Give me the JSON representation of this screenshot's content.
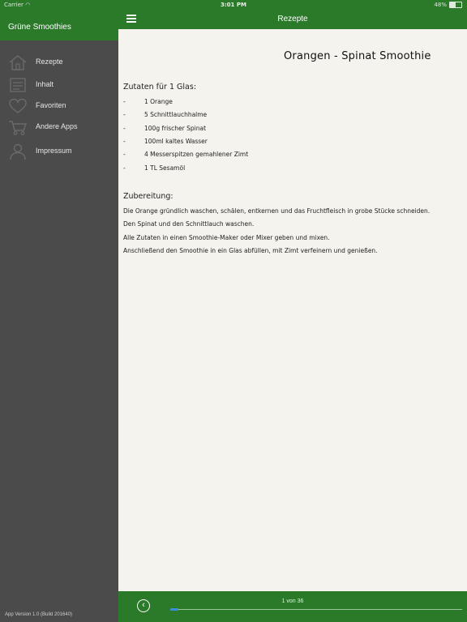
{
  "status": {
    "carrier": "Carrier",
    "time": "3:01 PM",
    "battery": "48%",
    "battery_level": 0.48
  },
  "sidebar": {
    "title": "Grüne Smoothies",
    "items": [
      {
        "label": "Rezepte",
        "icon": "house-icon"
      },
      {
        "label": "Inhalt",
        "icon": "contents-icon"
      },
      {
        "label": "Favoriten",
        "icon": "heart-icon"
      },
      {
        "label": "Andere Apps",
        "icon": "shopping-cart-icon"
      },
      {
        "label": "Impressum",
        "icon": "person-icon"
      }
    ],
    "app_version": "App Version 1.0 (Build 201640)"
  },
  "navbar": {
    "title": "Rezepte"
  },
  "recipe": {
    "title": "Orangen - Spinat Smoothie",
    "ingredients_heading": "Zutaten für 1 Glas:",
    "ingredients": [
      "1 Orange",
      "5 Schnittlauchhalme",
      "100g frischer Spinat",
      "100ml kaltes Wasser",
      "4 Messerspitzen gemahlener Zimt",
      "1 TL Sesamöl"
    ],
    "preparation_heading": "Zubereitung:",
    "preparation": [
      "Die Orange gründlich waschen, schälen, entkernen und das Fruchtfleisch in grobe Stücke schneiden.",
      "Den Spinat und den Schnittlauch waschen.",
      "Alle Zutaten in einen Smoothie-Maker oder Mixer geben und mixen.",
      "Anschließend den Smoothie in ein Glas abfüllen, mit Zimt verfeinern und genießen."
    ]
  },
  "pager": {
    "label": "1 von 36",
    "current": 1,
    "total": 36
  },
  "colors": {
    "accent_green": "#2a7a2a",
    "sidebar_bg": "#4b4b4b",
    "page_bg": "#f4f3ed",
    "progress_blue": "#3b8fd8"
  }
}
